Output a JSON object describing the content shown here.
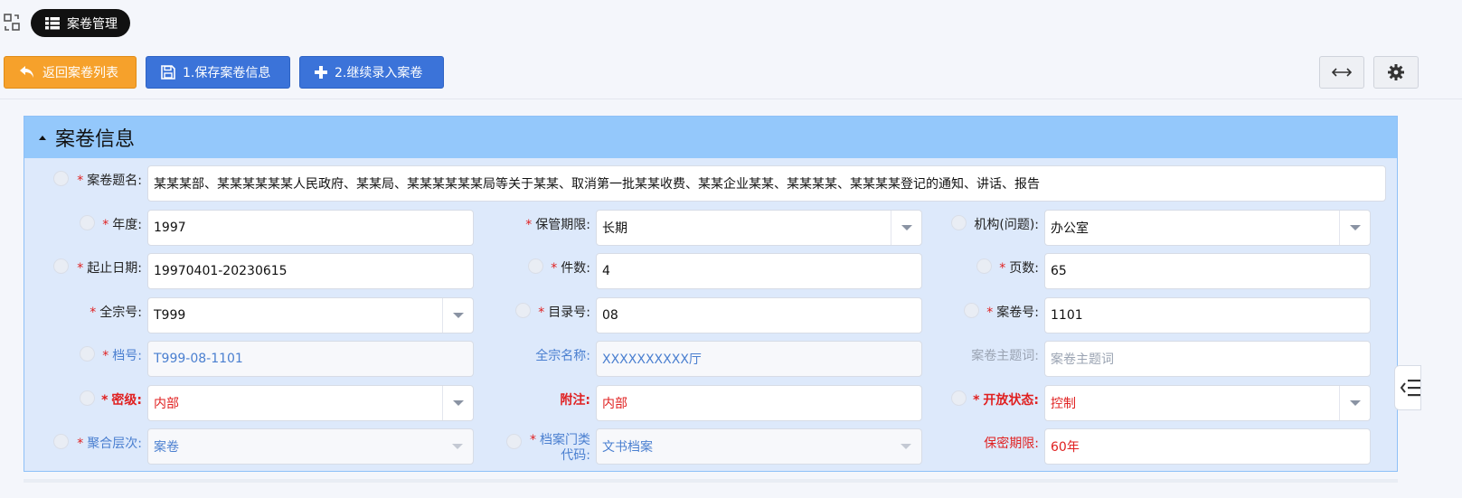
{
  "header": {
    "tab_label": "案卷管理"
  },
  "toolbar": {
    "back_label": "返回案卷列表",
    "save_label": "1.保存案卷信息",
    "continue_label": "2.继续录入案卷"
  },
  "panel": {
    "title": "案卷信息",
    "fields": {
      "title": {
        "label": "案卷题名:",
        "value": "某某某部、某某某某某某人民政府、某某局、某某某某某某局等关于某某、取消第一批某某收费、某某企业某某、某某某某、某某某某登记的通知、讲话、报告"
      },
      "year": {
        "label": "年度:",
        "value": "1997"
      },
      "retention": {
        "label": "保管期限:",
        "value": "长期"
      },
      "org": {
        "label": "机构(问题):",
        "value": "办公室"
      },
      "date_range": {
        "label": "起止日期:",
        "value": "19970401-20230615"
      },
      "item_count": {
        "label": "件数:",
        "value": "4"
      },
      "page_count": {
        "label": "页数:",
        "value": "65"
      },
      "fonds_no": {
        "label": "全宗号:",
        "value": "T999"
      },
      "catalog_no": {
        "label": "目录号:",
        "value": "08"
      },
      "volume_no": {
        "label": "案卷号:",
        "value": "1101"
      },
      "archive_no": {
        "label": "档号:",
        "value": "T999-08-1101"
      },
      "fonds_name": {
        "label": "全宗名称:",
        "value": "XXXXXXXXXX厅"
      },
      "subject": {
        "label": "案卷主题词:",
        "placeholder": "案卷主题词"
      },
      "secrecy": {
        "label": "密级:",
        "value": "内部"
      },
      "note": {
        "label": "附注:",
        "value": "内部"
      },
      "open_status": {
        "label": "开放状态:",
        "value": "控制"
      },
      "aggregation": {
        "label": "聚合层次:",
        "value": "案卷"
      },
      "category_code": {
        "label_line1": "档案门类",
        "label_line2": "代码:",
        "value": "文书档案"
      },
      "secret_period": {
        "label": "保密期限:",
        "value": "60年"
      }
    }
  },
  "required_mark": "*",
  "icons": [
    "swap-icon",
    "list-icon",
    "undo-icon",
    "save-icon",
    "plus-icon",
    "expand-icon",
    "gear-icon",
    "dropdown-icon"
  ]
}
